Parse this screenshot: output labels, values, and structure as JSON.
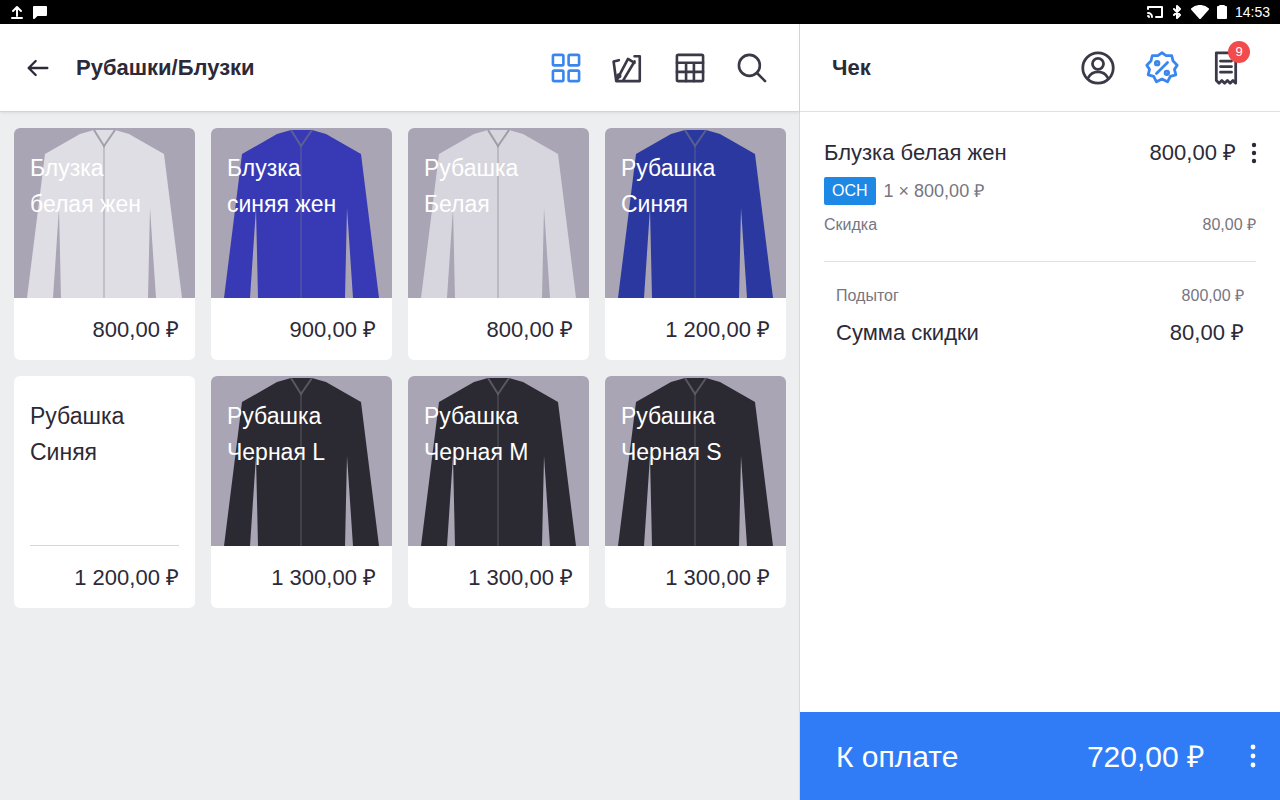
{
  "status_bar": {
    "time": "14:53"
  },
  "catalog": {
    "title": "Рубашки/Блузки",
    "tools": [
      {
        "selected": true
      },
      {
        "selected": false
      },
      {
        "selected": false
      },
      {
        "selected": false
      }
    ],
    "products": [
      {
        "name": "Блузка белая жен",
        "price": "800,00 ₽",
        "kind": "photo",
        "color": "#e6e4ea"
      },
      {
        "name": "Блузка синяя жен",
        "price": "900,00 ₽",
        "kind": "photo",
        "color": "#2a2fb4"
      },
      {
        "name": "Рубашка Белая",
        "price": "800,00 ₽",
        "kind": "photo",
        "color": "#dcdbe2"
      },
      {
        "name": "Рубашка Синяя",
        "price": "1 200,00 ₽",
        "kind": "photo",
        "color": "#1c2c9c"
      },
      {
        "name": "Рубашка Синяя",
        "price": "1 200,00 ₽",
        "kind": "plain",
        "color": "#ffffff"
      },
      {
        "name": "Рубашка Черная L",
        "price": "1 300,00 ₽",
        "kind": "photo",
        "color": "#1d1c22"
      },
      {
        "name": "Рубашка Черная M",
        "price": "1 300,00 ₽",
        "kind": "photo",
        "color": "#1d1c22"
      },
      {
        "name": "Рубашка Черная S",
        "price": "1 300,00 ₽",
        "kind": "photo",
        "color": "#1d1c22"
      }
    ]
  },
  "receipt": {
    "title": "Чек",
    "tools": [
      {
        "selected": false
      },
      {
        "selected": true
      },
      {
        "selected": false,
        "badge": "9"
      }
    ],
    "items": [
      {
        "name": "Блузка белая жен",
        "price": "800,00 ₽",
        "tax": "ОСН",
        "qty": "1 × 800,00 ₽",
        "discount_label": "Скидка",
        "discount": "80,00 ₽"
      }
    ],
    "totals": [
      {
        "label": "Подытог",
        "value": "800,00 ₽",
        "kind": "minor"
      },
      {
        "label": "Сумма скидки",
        "value": "80,00 ₽",
        "kind": "major"
      }
    ],
    "pay": {
      "label": "К оплате",
      "amount": "720,00 ₽"
    }
  }
}
